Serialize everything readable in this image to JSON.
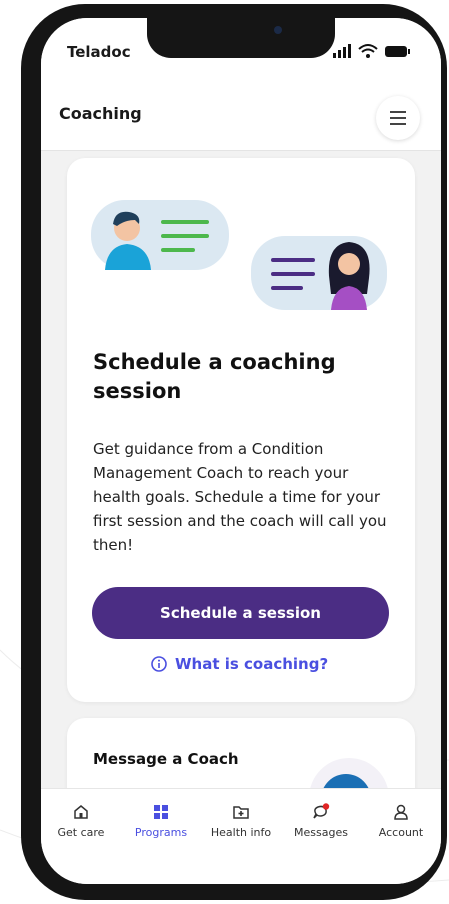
{
  "status_bar": {
    "carrier": "Teladoc"
  },
  "header": {
    "title": "Coaching",
    "menu_icon": "hamburger-menu-icon"
  },
  "coaching_card": {
    "heading": "Schedule a coaching session",
    "description": "Get guidance from a Condition Management Coach to reach your health goals. Schedule a time for your first session and the coach will call you then!",
    "button_label": "Schedule a session",
    "link_label": "What is coaching?"
  },
  "message_card": {
    "title": "Message a Coach"
  },
  "tabs": [
    {
      "label": "Get care",
      "icon": "home-icon",
      "active": false
    },
    {
      "label": "Programs",
      "icon": "grid-icon",
      "active": true
    },
    {
      "label": "Health info",
      "icon": "health-folder-icon",
      "active": false
    },
    {
      "label": "Messages",
      "icon": "messages-icon",
      "active": false
    },
    {
      "label": "Account",
      "icon": "account-icon",
      "active": false
    }
  ],
  "colors": {
    "primary": "#4b2d84",
    "link": "#4a4fe0",
    "notification": "#e02424",
    "screen_background": "#f2f2f2"
  }
}
